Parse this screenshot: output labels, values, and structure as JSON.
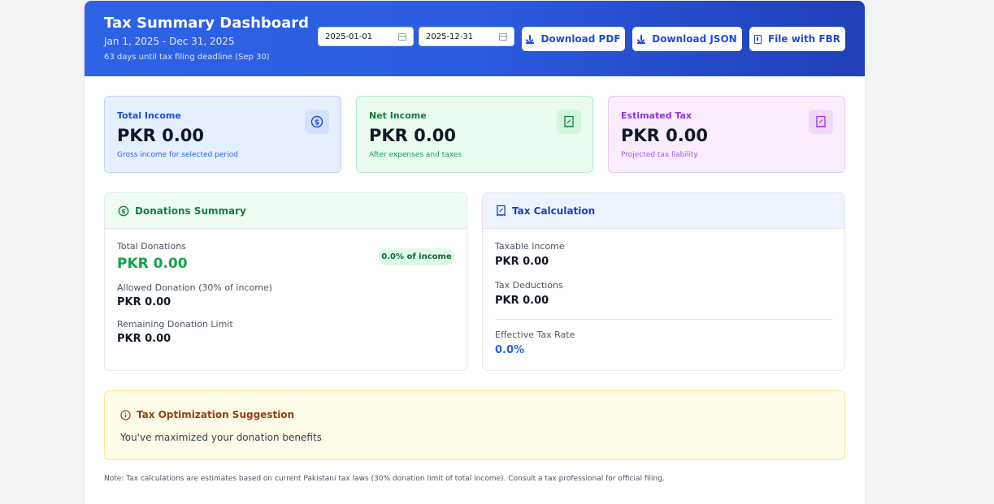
{
  "header": {
    "title": "Tax Summary Dashboard",
    "date_range": "Jan 1, 2025 - Dec 31, 2025",
    "deadline": "63 days until tax filing deadline (Sep 30)",
    "start_date": "2025-01-01",
    "end_date": "2025-12-31",
    "buttons": {
      "download_pdf": "Download PDF",
      "download_json": "Download JSON",
      "file_fbr": "File with FBR"
    }
  },
  "cards": [
    {
      "label": "Total Income",
      "value": "PKR 0.00",
      "sub": "Gross income for selected period",
      "icon": "dollar-circle-icon"
    },
    {
      "label": "Net Income",
      "value": "PKR 0.00",
      "sub": "After expenses and taxes",
      "icon": "receipt-icon"
    },
    {
      "label": "Estimated Tax",
      "value": "PKR 0.00",
      "sub": "Projected tax liability",
      "icon": "receipt-icon"
    }
  ],
  "donations": {
    "title": "Donations Summary",
    "total_label": "Total Donations",
    "total_value": "PKR 0.00",
    "badge": "0.0% of income",
    "allowed_label": "Allowed Donation (30% of income)",
    "allowed_value": "PKR 0.00",
    "remaining_label": "Remaining Donation Limit",
    "remaining_value": "PKR 0.00"
  },
  "tax_calc": {
    "title": "Tax Calculation",
    "taxable_label": "Taxable Income",
    "taxable_value": "PKR 0.00",
    "deductions_label": "Tax Deductions",
    "deductions_value": "PKR 0.00",
    "rate_label": "Effective Tax Rate",
    "rate_value": "0.0%"
  },
  "suggestion": {
    "title": "Tax Optimization Suggestion",
    "text": "You've maximized your donation benefits"
  },
  "note": "Note: Tax calculations are estimates based on current Pakistani tax laws (30% donation limit of total income). Consult a tax professional for official filing.",
  "colors": {
    "header_blue": "#2e63e6",
    "income_blue": "#1d4ed8",
    "net_green": "#15803d",
    "tax_purple": "#9333ea",
    "donation_green": "#16a34a",
    "suggest_brown": "#92400e"
  }
}
